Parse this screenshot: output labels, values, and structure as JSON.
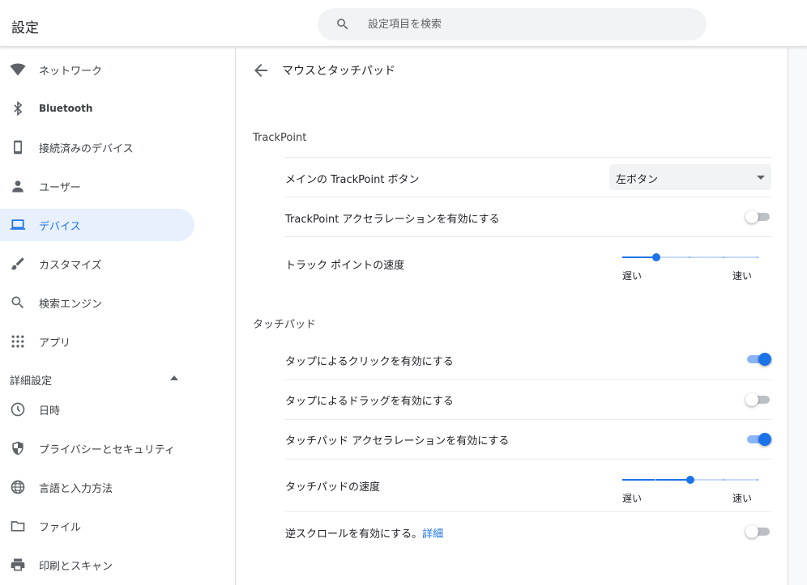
{
  "header": {
    "title": "設定",
    "search_placeholder": "設定項目を検索"
  },
  "sidebar": {
    "items": [
      {
        "label": "ネットワーク",
        "icon": "wifi-icon"
      },
      {
        "label": "Bluetooth",
        "icon": "bluetooth-icon"
      },
      {
        "label": "接続済みのデバイス",
        "icon": "phone-icon"
      },
      {
        "label": "ユーザー",
        "icon": "person-icon"
      },
      {
        "label": "デバイス",
        "icon": "laptop-icon",
        "active": true
      },
      {
        "label": "カスタマイズ",
        "icon": "brush-icon"
      },
      {
        "label": "検索エンジン",
        "icon": "search-icon"
      },
      {
        "label": "アプリ",
        "icon": "apps-grid-icon"
      }
    ],
    "advanced_label": "詳細設定",
    "advanced_items": [
      {
        "label": "日時",
        "icon": "clock-icon"
      },
      {
        "label": "プライバシーとセキュリティ",
        "icon": "shield-icon"
      },
      {
        "label": "言語と入力方法",
        "icon": "globe-icon"
      },
      {
        "label": "ファイル",
        "icon": "folder-icon"
      },
      {
        "label": "印刷とスキャン",
        "icon": "printer-icon"
      }
    ]
  },
  "main": {
    "page_title": "マウスとタッチパッド",
    "trackpoint": {
      "section_title": "TrackPoint",
      "primary_button_label": "メインの TrackPoint ボタン",
      "primary_button_value": "左ボタン",
      "acceleration_label": "TrackPoint アクセラレーションを有効にする",
      "acceleration_on": false,
      "speed_label": "トラック ポイントの速度",
      "speed_value": 0.25,
      "speed_min_label": "遅い",
      "speed_max_label": "速い"
    },
    "touchpad": {
      "section_title": "タッチパッド",
      "tap_to_click_label": "タップによるクリックを有効にする",
      "tap_to_click_on": true,
      "tap_drag_label": "タップによるドラッグを有効にする",
      "tap_drag_on": false,
      "acceleration_label": "タッチパッド アクセラレーションを有効にする",
      "acceleration_on": true,
      "speed_label": "タッチパッドの速度",
      "speed_value": 0.5,
      "speed_min_label": "遅い",
      "speed_max_label": "速い",
      "reverse_scroll_label": "逆スクロールを有効にする。",
      "reverse_scroll_link": "詳細",
      "reverse_scroll_on": false
    }
  },
  "colors": {
    "accent": "#1a73e8",
    "active_bg": "#e8f0fe",
    "toggle_on_track": "#8ab4f8",
    "toggle_off_track": "#bdc1c6"
  }
}
